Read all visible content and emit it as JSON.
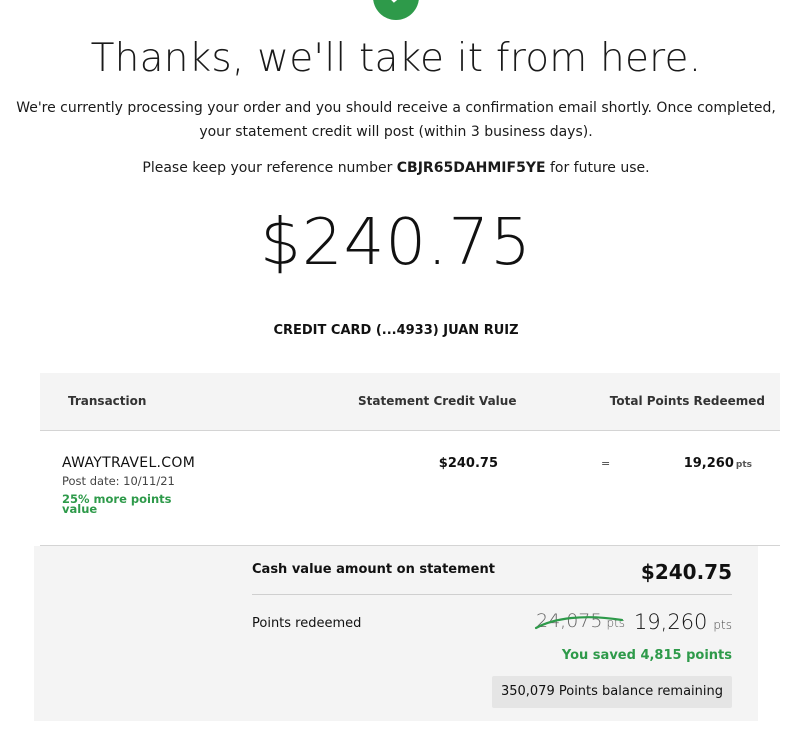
{
  "confirmation": {
    "headline": "Thanks, we'll take it from here.",
    "message": "We're currently processing your order and you should receive a confirmation email shortly. Once completed, your statement credit will post (within 3 business days).",
    "reference_prefix": "Please keep your reference number",
    "reference_number": "CBJR65DAHMIF5YE",
    "reference_suffix": "for future use.",
    "amount": "$240.75",
    "card_label": "CREDIT CARD (...4933) JUAN RUIZ"
  },
  "table": {
    "headers": {
      "transaction": "Transaction",
      "statement_credit": "Statement Credit Value",
      "total_points": "Total Points Redeemed"
    },
    "rows": [
      {
        "merchant": "AWAYTRAVEL.COM",
        "post_date": "Post date: 10/11/21",
        "promo": "25% more points value",
        "credit_value": "$240.75",
        "equals": "=",
        "points": "19,260",
        "points_unit": "pts"
      }
    ]
  },
  "summary": {
    "cash_label": "Cash value amount on statement",
    "cash_value": "$240.75",
    "points_label": "Points redeemed",
    "original_points": "24,075",
    "original_points_unit": "pts",
    "redeemed_points": "19,260",
    "redeemed_points_unit": "pts",
    "savings": "You saved 4,815 points",
    "balance": "350,079 Points balance remaining"
  },
  "colors": {
    "accent_green": "#2e9a4a",
    "panel_gray": "#f4f4f4"
  },
  "icons": {
    "status": "checkmark-icon"
  }
}
